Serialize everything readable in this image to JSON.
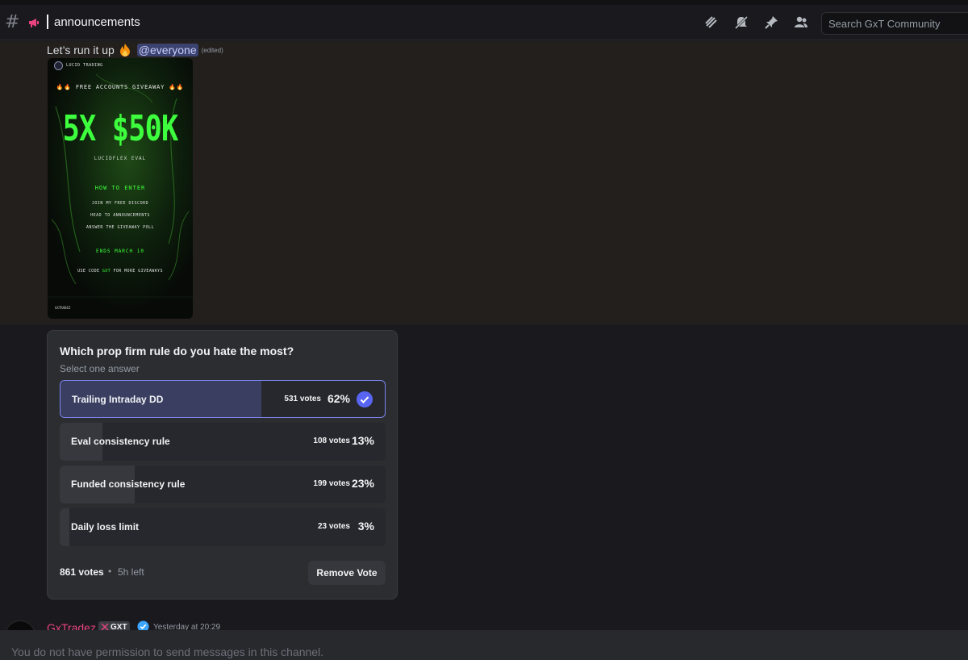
{
  "header": {
    "channel_name": "announcements",
    "search_placeholder": "Search GxT Community",
    "icons": [
      "threads-icon",
      "mute-icon",
      "pin-icon",
      "member-list-icon"
    ]
  },
  "message": {
    "text": "Let’s run it up",
    "emoji": "fire-emoji",
    "mention": "@everyone",
    "edited": "(edited)"
  },
  "poster": {
    "brand": "LUCID TRADING",
    "giveaway": "FREE ACCOUNTS GIVEAWAY",
    "amount": "5X $50K",
    "eval": "LUCIDFLEX EVAL",
    "how_to": "HOW TO ENTER",
    "steps": [
      "JOIN MY FREE DISCORD",
      "HEAD TO ANNOUNCEMENTS",
      "ANSWER THE GIVEAWAY POLL"
    ],
    "ends": "ENDS MARCH 10",
    "code_prefix": "USE CODE",
    "code": "GXT",
    "code_suffix": "FOR MORE GIVEAWAYS",
    "footer": "GXTRADEZ"
  },
  "poll": {
    "question": "Which prop firm rule do you hate the most?",
    "subtitle": "Select one answer",
    "options": [
      {
        "label": "Trailing Intraday DD",
        "votes": "531 votes",
        "pct": "62%",
        "fraction": 0.62,
        "selected": true
      },
      {
        "label": "Eval consistency rule",
        "votes": "108 votes",
        "pct": "13%",
        "fraction": 0.13,
        "selected": false
      },
      {
        "label": "Funded consistency rule",
        "votes": "199 votes",
        "pct": "23%",
        "fraction": 0.23,
        "selected": false
      },
      {
        "label": "Daily loss limit",
        "votes": "23 votes",
        "pct": "3%",
        "fraction": 0.03,
        "selected": false
      }
    ],
    "total": "861 votes",
    "dot": "•",
    "time_left": "5h left",
    "remove_vote": "Remove Vote"
  },
  "next_message": {
    "author": "GxTradez",
    "tag": "GXT",
    "timestamp": "Yesterday at 20:29"
  },
  "composer": {
    "notice": "You do not have permission to send messages in this channel."
  },
  "colors": {
    "accent": "#5865f2",
    "mention_bg": "#3c4270",
    "poster_green": "#3dff3d",
    "author": "#e8437c"
  }
}
